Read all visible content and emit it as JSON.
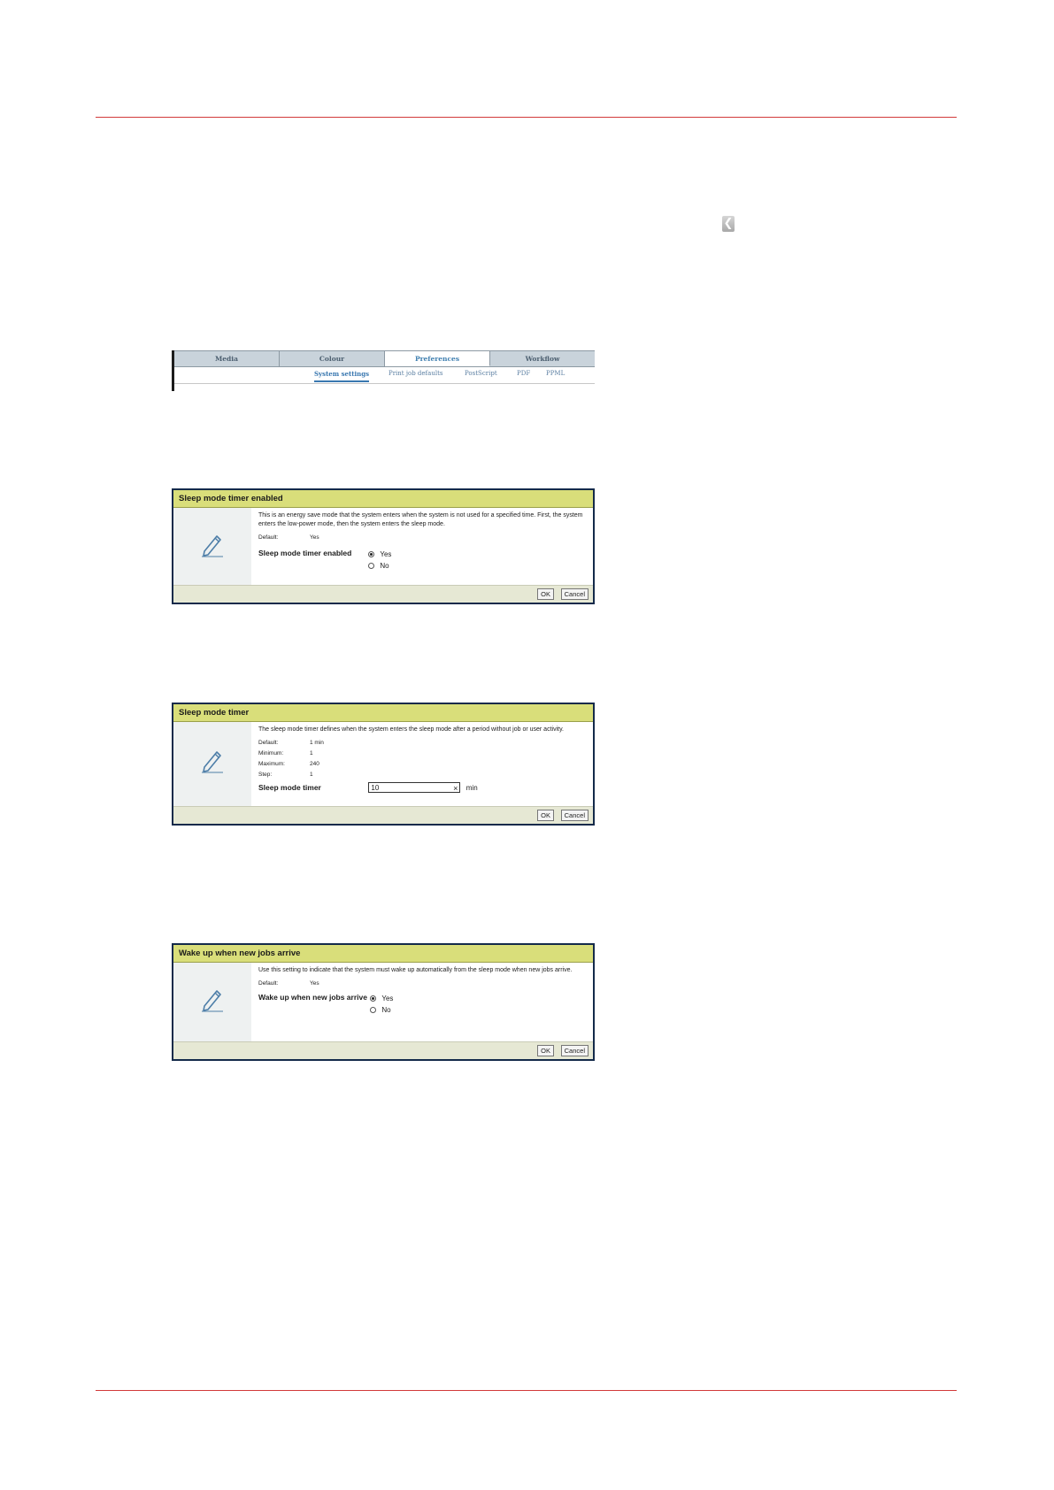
{
  "toolbar": {
    "back_glyph": "❮"
  },
  "tabs": {
    "main": [
      {
        "label": "Media"
      },
      {
        "label": "Colour"
      },
      {
        "label": "Preferences"
      },
      {
        "label": "Workflow"
      }
    ],
    "sub": [
      {
        "label": "System settings"
      },
      {
        "label": "Print job defaults"
      },
      {
        "label": "PostScript"
      },
      {
        "label": "PDF"
      },
      {
        "label": "PPML"
      }
    ],
    "active_main": "Preferences",
    "active_sub": "System settings"
  },
  "dialogs": {
    "sleep_enabled": {
      "title": "Sleep mode timer enabled",
      "description": "This is an energy save mode that the system enters when the system is not used for a specified time. First, the system enters the low-power mode, then the system enters the sleep mode.",
      "default_label": "Default:",
      "default_value": "Yes",
      "setting_label": "Sleep mode timer enabled",
      "options": [
        "Yes",
        "No"
      ],
      "selected": "Yes",
      "ok_label": "OK",
      "cancel_label": "Cancel"
    },
    "sleep_timer": {
      "title": "Sleep mode timer",
      "description": "The sleep mode timer defines when the system enters the sleep mode after a period without job or user activity.",
      "default_label": "Default:",
      "default_value": "1 min",
      "minimum_label": "Minimum:",
      "minimum_value": "1",
      "maximum_label": "Maximum:",
      "maximum_value": "240",
      "step_label": "Step:",
      "step_value": "1",
      "setting_label": "Sleep mode timer",
      "input_value": "10",
      "unit": "min",
      "ok_label": "OK",
      "cancel_label": "Cancel"
    },
    "wake_up": {
      "title": "Wake up when new jobs arrive",
      "description": "Use this setting to indicate that the system must wake up automatically from the sleep mode when new jobs arrive.",
      "default_label": "Default:",
      "default_value": "Yes",
      "setting_label": "Wake up when new jobs arrive",
      "options": [
        "Yes",
        "No"
      ],
      "selected": "Yes",
      "ok_label": "OK",
      "cancel_label": "Cancel"
    }
  }
}
